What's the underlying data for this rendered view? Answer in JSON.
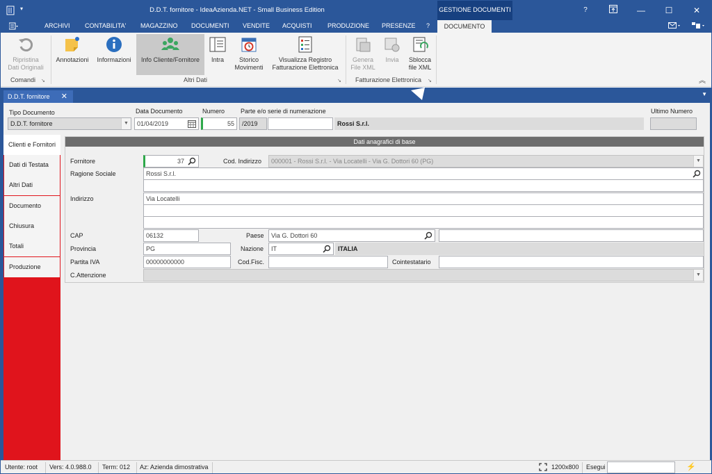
{
  "app": {
    "title": "D.D.T. fornitore - IdeaAzienda.NET - Small Business Edition",
    "context_tab": "GESTIONE DOCUMENTI",
    "window_buttons": [
      "?",
      "⊡",
      "—",
      "☐",
      "✕"
    ]
  },
  "menu": {
    "items": [
      "ARCHIVI",
      "CONTABILITA'",
      "MAGAZZINO",
      "DOCUMENTI",
      "VENDITE",
      "ACQUISTI",
      "PRODUZIONE",
      "PRESENZE",
      "?"
    ],
    "active": "DOCUMENTO"
  },
  "ribbon": {
    "comandi": {
      "label": "Comandi",
      "ripristina": "Ripristina\nDati Originali"
    },
    "altri_dati": {
      "label": "Altri Dati",
      "annotazioni": "Annotazioni",
      "informazioni": "Informazioni",
      "info_cliente": "Info Cliente/Fornitore",
      "intra": "Intra",
      "storico": "Storico\nMovimenti",
      "visualizza": "Visualizza Registro\nFatturazione Elettronica"
    },
    "fatturazione": {
      "label": "Fatturazione Elettronica",
      "genera": "Genera\nFile XML",
      "invia": "Invia",
      "sblocca": "Sblocca\nfile XML"
    }
  },
  "doc_tab": {
    "label": "D.D.T. fornitore"
  },
  "header": {
    "tipo_label": "Tipo Documento",
    "tipo_value": "D.D.T. fornitore",
    "data_label": "Data Documento",
    "data_value": "01/04/2019",
    "numero_label": "Numero",
    "numero_value": "55",
    "parte_label": "Parte e/o serie di numerazione",
    "parte_value": "/2019",
    "supplier_name": "Rossi S.r.l.",
    "ultimo_label": "Ultimo Numero",
    "ultimo_value": ""
  },
  "side_tabs": [
    "Clienti e Fornitori",
    "Dati di Testata",
    "Altri Dati",
    "Documento",
    "Chiusura",
    "Totali",
    "Produzione"
  ],
  "section": {
    "title": "Dati anagrafici di base",
    "fornitore_label": "Fornitore",
    "fornitore_value": "37",
    "cod_indirizzo_label": "Cod. Indirizzo",
    "cod_indirizzo_value": "000001 - Rossi S.r.l. - Via Locatelli - Via G. Dottori 60 (PG)",
    "ragione_label": "Ragione Sociale",
    "ragione_value": "Rossi S.r.l.",
    "indirizzo_label": "Indirizzo",
    "indirizzo_value": "Via Locatelli",
    "cap_label": "CAP",
    "cap_value": "06132",
    "paese_label": "Paese",
    "paese_value": "Via G. Dottori 60",
    "provincia_label": "Provincia",
    "provincia_value": "PG",
    "nazione_label": "Nazione",
    "nazione_value": "IT",
    "nazione_name": "ITALIA",
    "piva_label": "Partita IVA",
    "piva_value": "00000000000",
    "codfisc_label": "Cod.Fisc.",
    "codfisc_value": "",
    "cointestatario_label": "Cointestatario",
    "cointestatario_value": "",
    "attenzione_label": "C.Attenzione",
    "attenzione_value": ""
  },
  "status": {
    "utente": "Utente: root",
    "vers": "Vers: 4.0.988.0",
    "term": "Term: 012",
    "az": "Az: Azienda dimostrativa",
    "resolution": "1200x800",
    "esegui": "Esegui"
  }
}
